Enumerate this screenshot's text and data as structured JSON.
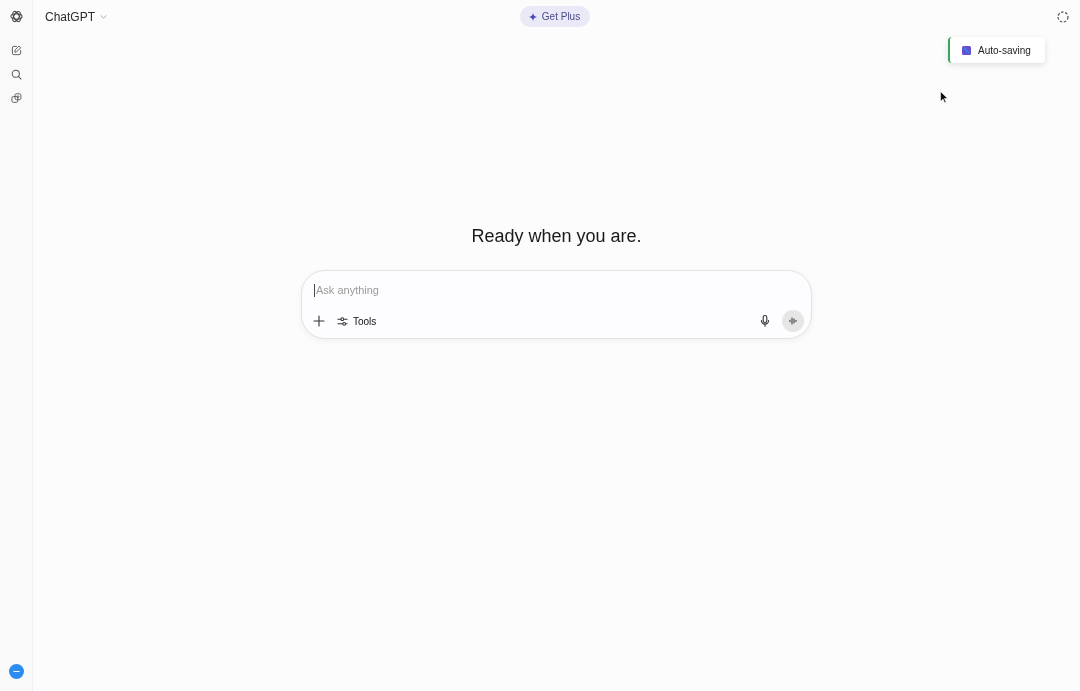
{
  "header": {
    "title": "ChatGPT",
    "upgrade_label": "Get Plus"
  },
  "toast": {
    "text": "Auto-saving"
  },
  "main": {
    "heading": "Ready when you are."
  },
  "composer": {
    "placeholder": "Ask anything",
    "tools_label": "Tools"
  }
}
